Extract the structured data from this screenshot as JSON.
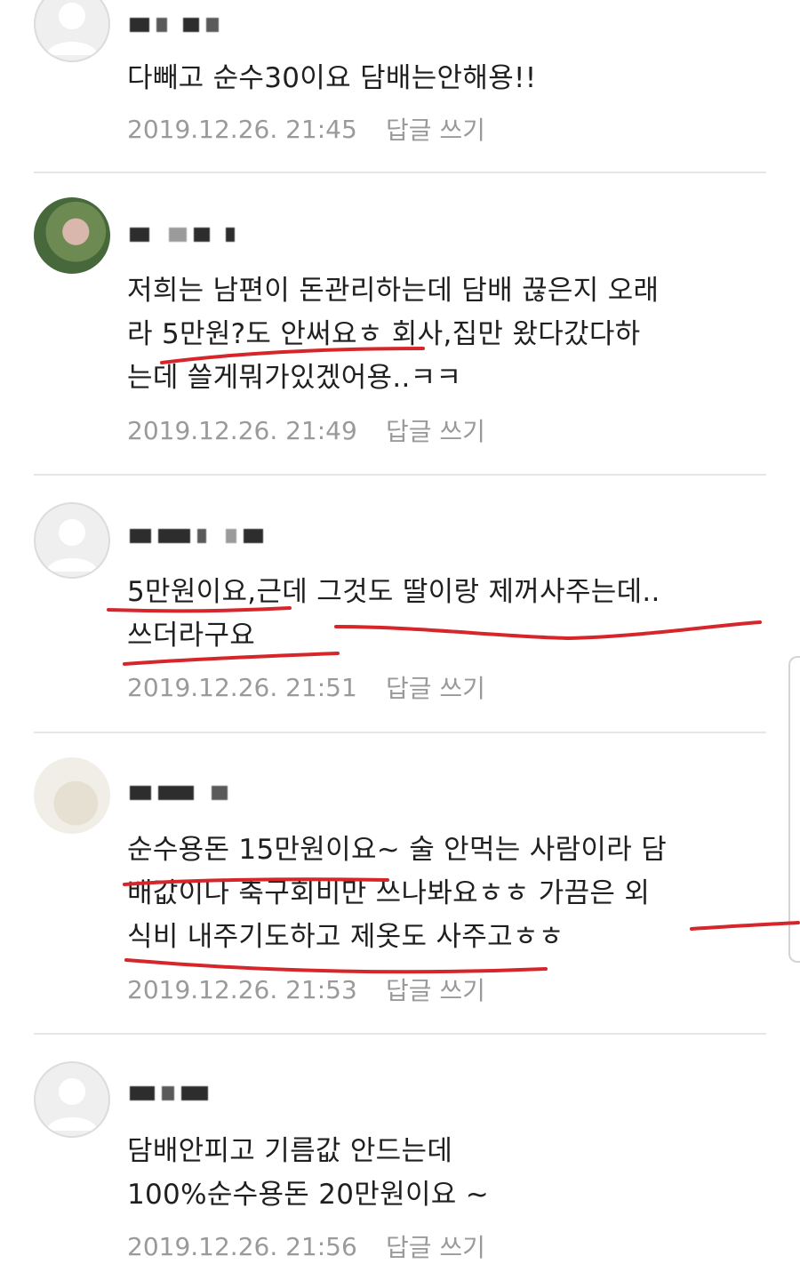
{
  "comments": [
    {
      "lines": [
        "다빼고 순수30이요 담배는안해용!!"
      ],
      "date": "2019.12.26. 21:45",
      "reply": "답글 쓰기",
      "avatar": "default-profile-icon"
    },
    {
      "lines": [
        "저희는 남편이 돈관리하는데 담배 끊은지 오래",
        "라 5만원?도 안써요ㅎ 회사,집만 왔다갔다하",
        "는데 쓸게뭐가있겠어용..ㅋㅋ"
      ],
      "date": "2019.12.26. 21:49",
      "reply": "답글 쓰기",
      "avatar": "blurred-photo"
    },
    {
      "lines": [
        "5만원이요,근데 그것도 딸이랑 제꺼사주는데..",
        "쓰더라구요"
      ],
      "date": "2019.12.26. 21:51",
      "reply": "답글 쓰기",
      "avatar": "default-profile-icon"
    },
    {
      "lines": [
        "순수용돈 15만원이요~ 술 안먹는 사람이라 담",
        "배값이나 축구회비만 쓰나봐요ㅎㅎ 가끔은 외",
        "식비 내주기도하고 제옷도 사주고ㅎㅎ"
      ],
      "date": "2019.12.26. 21:53",
      "reply": "답글 쓰기",
      "avatar": "blurred-photo"
    },
    {
      "lines": [
        "담배안피고 기름값 안드는데",
        "100%순수용돈 20만원이요 ~"
      ],
      "date": "2019.12.26. 21:56",
      "reply": "답글 쓰기",
      "avatar": "default-profile-icon"
    }
  ],
  "colors": {
    "text": "#1f1f1f",
    "meta": "#9a9a9a",
    "divider": "#e6e6e6",
    "annotation": "#d7262b"
  }
}
